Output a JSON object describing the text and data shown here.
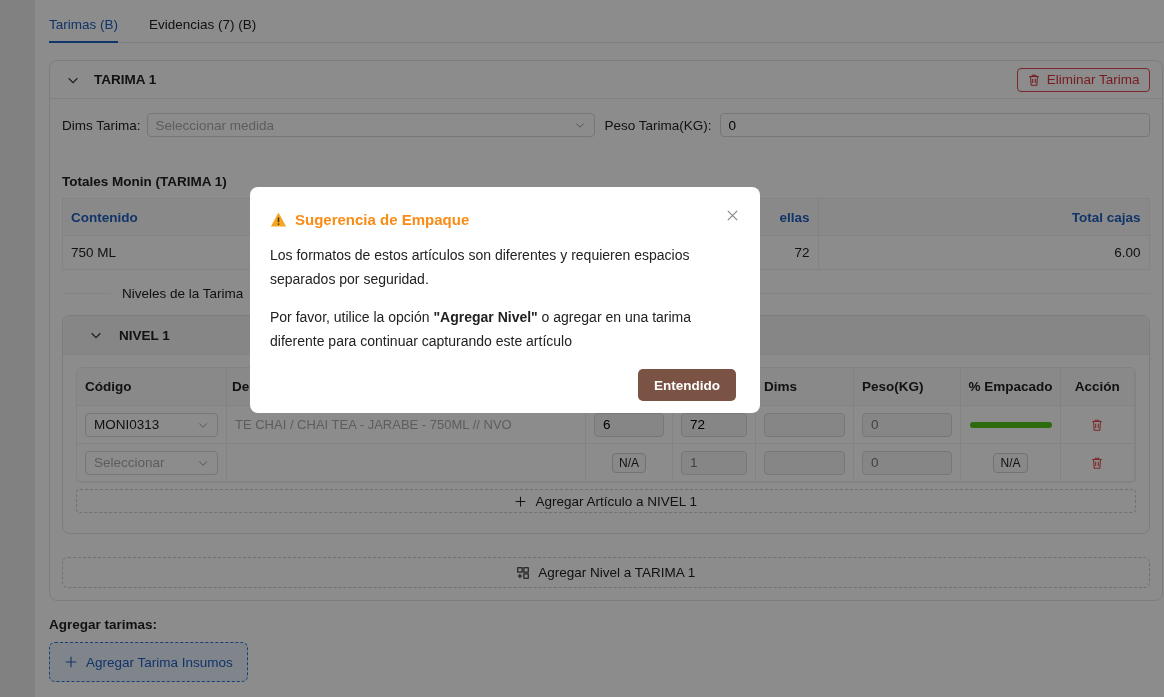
{
  "tabs": [
    {
      "label": "Tarimas (B)",
      "selected": true
    },
    {
      "label": "Evidencias (7) (B)",
      "selected": false
    }
  ],
  "tarima": {
    "title": "TARIMA 1",
    "expanded": true,
    "delete_button": "Eliminar Tarima",
    "dims_label": "Dims Tarima:",
    "dims_placeholder": "Seleccionar medida",
    "peso_label": "Peso Tarima(KG):",
    "peso_value": "0",
    "totals_title": "Totales Monin (TARIMA 1)",
    "totals": {
      "columns": [
        "Contenido",
        "ellas",
        "Total cajas"
      ],
      "rows": [
        [
          "750 ML",
          "72",
          "6.00"
        ]
      ]
    },
    "levels_divider": "Niveles de la Tarima",
    "levels": [
      {
        "title": "NIVEL 1",
        "expanded": true,
        "columns": [
          {
            "label": "Código"
          },
          {
            "label": "De"
          },
          {},
          {},
          {
            "label": "Dims"
          },
          {
            "label": "Peso(KG)"
          },
          {
            "label": "% Empacado"
          },
          {
            "label": "Acción"
          }
        ],
        "rows": [
          {
            "code": {
              "value": "MONI0313"
            },
            "description": "TE CHAI / CHAI TEA - JARABE - 750ML // NVO",
            "column_3": {
              "kind": "input",
              "value": "6"
            },
            "column_4": {
              "kind": "input",
              "value": "72"
            },
            "peso": {
              "placeholder": "0"
            },
            "packed": {
              "kind": "bar",
              "level": 1
            }
          },
          {
            "code": {
              "placeholder": "Seleccionar"
            },
            "column_3": {
              "kind": "tag",
              "text": "N/A"
            },
            "column_4": {
              "kind": "input",
              "placeholder": "1"
            },
            "peso": {
              "placeholder": "0"
            },
            "packed": {
              "kind": "tag",
              "text": "N/A"
            }
          }
        ],
        "add_button": "Agregar Artículo a NIVEL 1"
      }
    ],
    "add_level_button": "Agregar Nivel a TARIMA 1"
  },
  "add_section": {
    "label": "Agregar tarimas:",
    "button": "Agregar Tarima Insumos"
  },
  "modal": {
    "open": true,
    "title": "Sugerencia de Empaque",
    "paragraphs": [
      "Los formatos de estos artículos son diferentes y requieren espacios separados por seguridad.",
      "Por favor, utilice la opción **\"Agregar Nivel\"** o agregar en una tarima diferente para continuar capturando este artículo"
    ],
    "button": "Entendido"
  }
}
